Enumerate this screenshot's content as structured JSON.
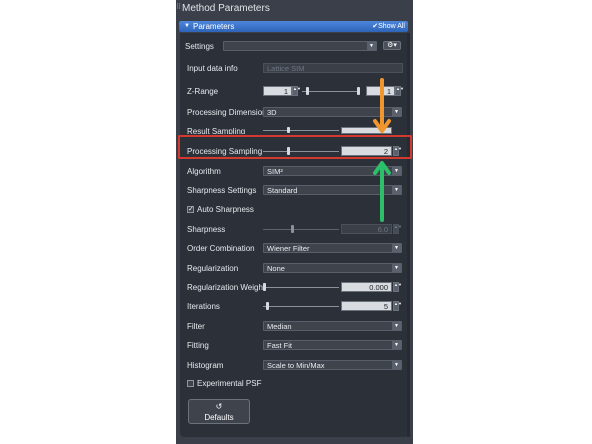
{
  "panel": {
    "title": "Method Parameters"
  },
  "section": {
    "label": "Parameters",
    "show_all": "Show All"
  },
  "settings": {
    "label": "Settings",
    "value": ""
  },
  "input_data_info": {
    "label": "Input data info",
    "value": "Lattice SIM"
  },
  "z_range": {
    "label": "Z-Range",
    "start": "1",
    "end": "1"
  },
  "processing_dimension": {
    "label": "Processing Dimension",
    "value": "3D"
  },
  "result_sampling": {
    "label": "Result Sampling"
  },
  "processing_sampling": {
    "label": "Processing Sampling",
    "value": "2"
  },
  "algorithm": {
    "label": "Algorithm",
    "value": "SIM²"
  },
  "sharpness_settings": {
    "label": "Sharpness Settings",
    "value": "Standard"
  },
  "auto_sharpness": {
    "label": "Auto Sharpness",
    "checked": true
  },
  "sharpness": {
    "label": "Sharpness",
    "value": "6.0"
  },
  "order_combination": {
    "label": "Order Combination",
    "value": "Wiener Filter"
  },
  "regularization": {
    "label": "Regularization",
    "value": "None"
  },
  "regularization_weight": {
    "label": "Regularization Weight",
    "value": "0.000"
  },
  "iterations": {
    "label": "Iterations",
    "value": "5"
  },
  "filter": {
    "label": "Filter",
    "value": "Median"
  },
  "fitting": {
    "label": "Fitting",
    "value": "Fast Fit"
  },
  "histogram": {
    "label": "Histogram",
    "value": "Scale to Min/Max"
  },
  "experimental_psf": {
    "label": "Experimental PSF",
    "checked": false
  },
  "defaults_button": {
    "label": "Defaults"
  },
  "colors": {
    "panel_bg": "#3a3f49",
    "content_bg": "#2c3139",
    "header_blue": "#3b74cc",
    "highlight_red": "#d23a2f",
    "arrow_orange": "#f0962c",
    "arrow_green": "#2bbf6a"
  }
}
